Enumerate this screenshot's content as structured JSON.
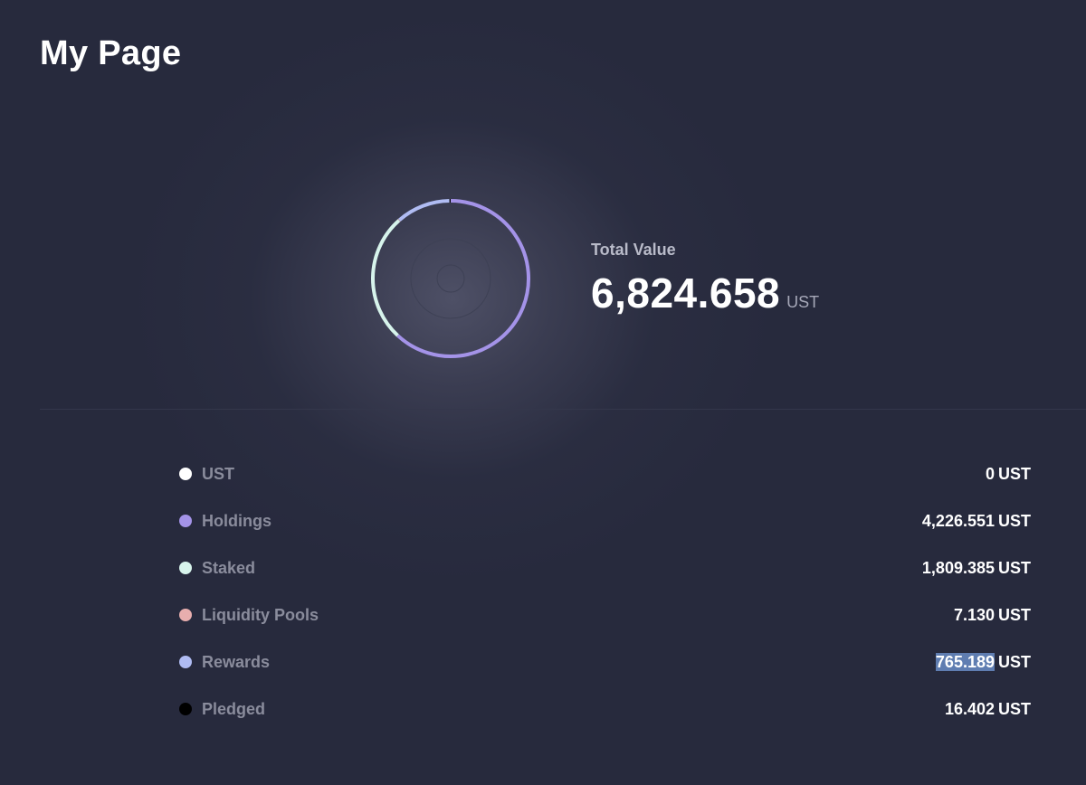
{
  "page": {
    "title": "My Page"
  },
  "total": {
    "label": "Total Value",
    "value": "6,824.658",
    "unit": "UST"
  },
  "chart_data": {
    "type": "pie",
    "categories": [
      "UST",
      "Holdings",
      "Staked",
      "Liquidity Pools",
      "Rewards",
      "Pledged"
    ],
    "values": [
      0,
      4226.551,
      1809.385,
      7.13,
      765.189,
      16.402
    ],
    "colors": [
      "#ffffff",
      "#a493e8",
      "#d7f4ec",
      "#e8aeae",
      "#b0bcf3",
      "#000000"
    ],
    "title": "",
    "style": "donut"
  },
  "legend": {
    "items": [
      {
        "label": "UST",
        "value": "0",
        "unit": "UST",
        "color": "#ffffff",
        "selected": false
      },
      {
        "label": "Holdings",
        "value": "4,226.551",
        "unit": "UST",
        "color": "#a493e8",
        "selected": false
      },
      {
        "label": "Staked",
        "value": "1,809.385",
        "unit": "UST",
        "color": "#d7f4ec",
        "selected": false
      },
      {
        "label": "Liquidity Pools",
        "value": "7.130",
        "unit": "UST",
        "color": "#e8aeae",
        "selected": false
      },
      {
        "label": "Rewards",
        "value": "765.189",
        "unit": "UST",
        "color": "#b0bcf3",
        "selected": true
      },
      {
        "label": "Pledged",
        "value": "16.402",
        "unit": "UST",
        "color": "#000000",
        "selected": false
      }
    ]
  }
}
